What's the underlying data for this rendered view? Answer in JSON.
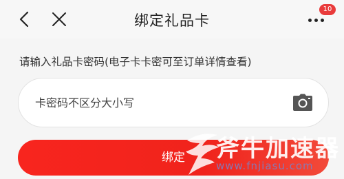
{
  "header": {
    "title": "绑定礼品卡",
    "badge_count": "10",
    "icons": [
      "chevron-left-icon",
      "close-icon",
      "more-dots-icon"
    ]
  },
  "hint": "请输入礼品卡密码(电子卡卡密可至订单详情查看)",
  "card_input": {
    "placeholder": "卡密码不区分大小写",
    "value": "",
    "icon": "camera-icon"
  },
  "bind_button": {
    "label": "绑定"
  },
  "watermark": {
    "text": "斧牛加速器",
    "url": "www.fnjiasu.com"
  },
  "colors": {
    "accent": "#f8251e",
    "background": "#f5f5f5",
    "badge": "#e93b3b"
  }
}
